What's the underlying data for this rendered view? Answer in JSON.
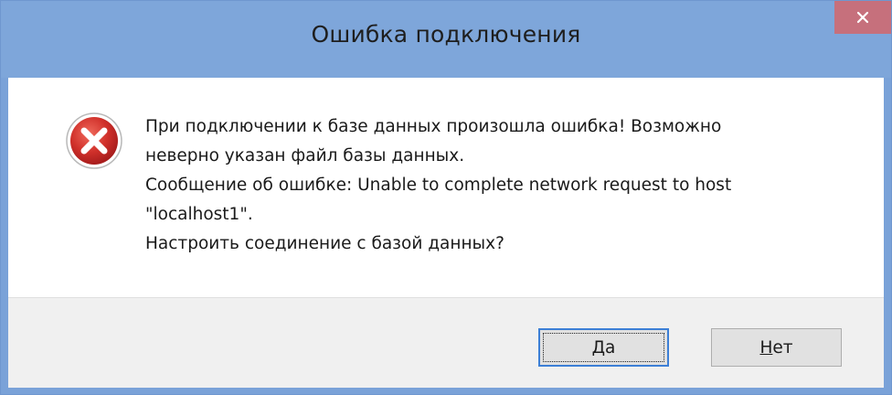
{
  "dialog": {
    "title": "Ошибка подключения",
    "close_label": "×"
  },
  "icon": {
    "name": "error-icon",
    "color": "#c8262a"
  },
  "message": {
    "lines": [
      "При подключении к базе данных произошла ошибка! Возможно",
      "неверно указан файл базы данных.",
      "Сообщение об ошибке: Unable to complete network request to host",
      "\"localhost1\".",
      "Настроить соединение с базой данных?"
    ]
  },
  "buttons": {
    "yes": {
      "mnemonic": "Д",
      "rest": "а"
    },
    "no": {
      "mnemonic": "Н",
      "rest": "ет"
    }
  },
  "colors": {
    "titlebar": "#7ea6da",
    "close": "#c6707c",
    "default_border": "#3c7fd6"
  }
}
